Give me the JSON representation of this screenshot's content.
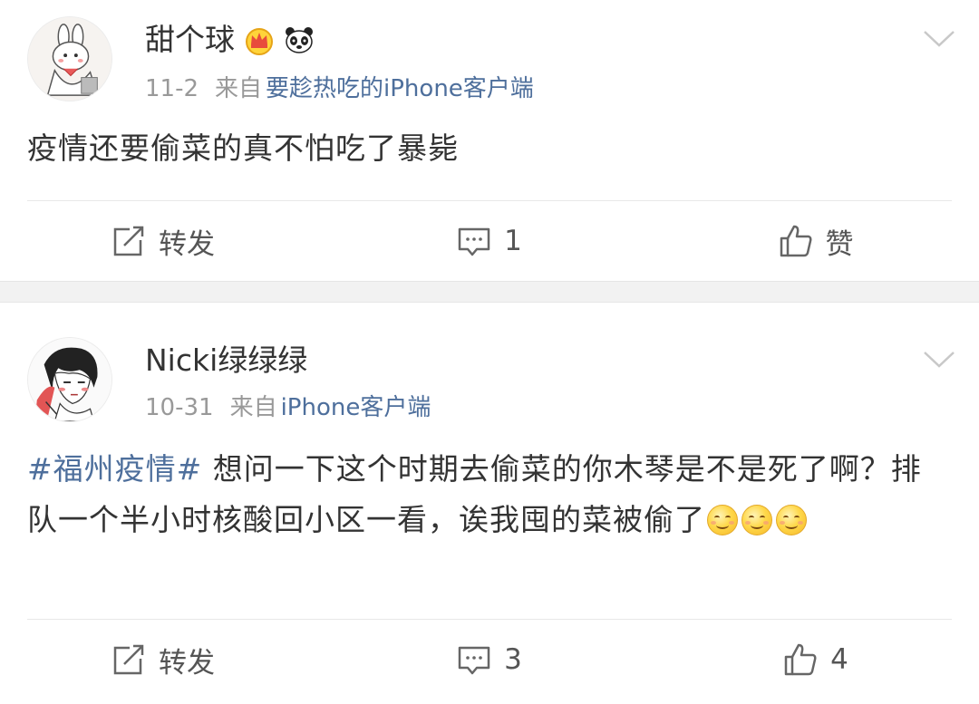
{
  "posts": [
    {
      "user": {
        "name": "甜个球",
        "badges": [
          "crown-icon",
          "panda-icon"
        ]
      },
      "date": "11-2",
      "from_label": "来自",
      "source": "要趁热吃的iPhone客户端",
      "content": "疫情还要偷菜的真不怕吃了暴毙",
      "actions": {
        "repost": "转发",
        "comment": "1",
        "like": "赞"
      }
    },
    {
      "user": {
        "name": "Nicki绿绿绿"
      },
      "date": "10-31",
      "from_label": "来自",
      "source": "iPhone客户端",
      "hashtag": "#福州疫情#",
      "content": " 想问一下这个时期去偷菜的你木琴是不是死了啊？排队一个半小时核酸回小区一看，诶我囤的菜被偷了",
      "emoji_count": 3,
      "actions": {
        "repost": "转发",
        "comment": "3",
        "like": "4"
      }
    }
  ],
  "colors": {
    "link": "#4e6f9c",
    "text": "#333333",
    "meta": "#999999",
    "gap": "#f2f2f2"
  }
}
